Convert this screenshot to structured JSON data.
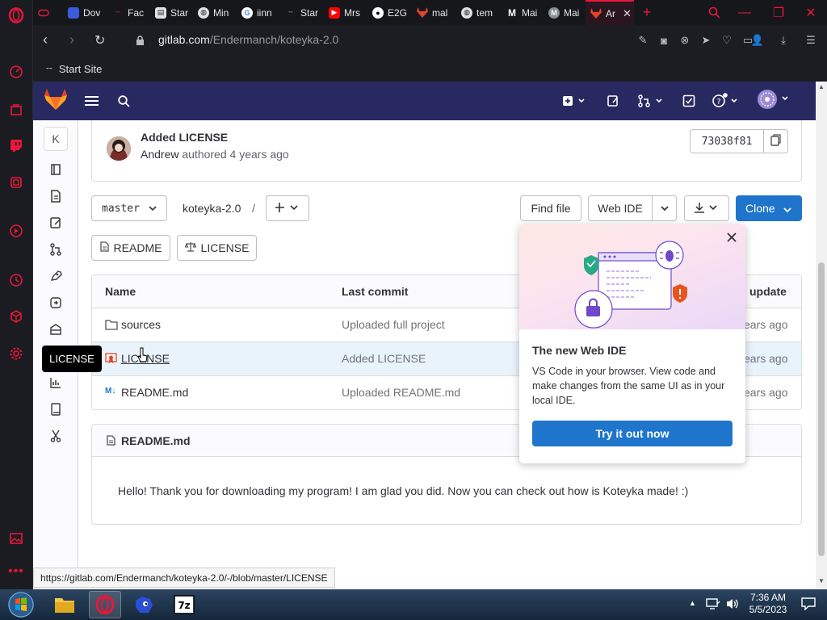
{
  "browser": {
    "tabs": [
      {
        "label": "",
        "fav_color": "#e8173a",
        "icon": "gamepad-icon"
      },
      {
        "label": "Dov",
        "fav_color": "#3b5bdb",
        "icon": "sonic-icon"
      },
      {
        "label": "Fac",
        "fav_color": "#e03131",
        "icon": "dash-icon"
      },
      {
        "label": "Star",
        "fav_color": "#dee2e6",
        "icon": "doc-icon"
      },
      {
        "label": "Min",
        "fav_color": "#dee2e6",
        "icon": "globe-icon"
      },
      {
        "label": "iinn",
        "fav_color": "#ffffff",
        "icon": "google-icon"
      },
      {
        "label": "Star",
        "fav_color": "#868e96",
        "icon": "dash-icon"
      },
      {
        "label": "Mrs",
        "fav_color": "#ff0000",
        "icon": "youtube-icon"
      },
      {
        "label": "E2G",
        "fav_color": "#ffffff",
        "icon": "github-icon"
      },
      {
        "label": "mal",
        "fav_color": "#e24329",
        "icon": "gitlab-icon"
      },
      {
        "label": "tem",
        "fav_color": "#dee2e6",
        "icon": "globe-icon"
      },
      {
        "label": "Mai",
        "fav_color": "#ffffff",
        "icon": "m-icon"
      },
      {
        "label": "Mai",
        "fav_color": "#868e96",
        "icon": "m-icon"
      },
      {
        "label": "Ar",
        "fav_color": "#e24329",
        "icon": "gitlab-icon",
        "active": true
      }
    ],
    "url_host": "gitlab.com",
    "url_path": "/Endermanch/koteyka-2.0",
    "bookmark": "Start Site",
    "status_url": "https://gitlab.com/Endermanch/koteyka-2.0/-/blob/master/LICENSE"
  },
  "project": {
    "avatar_letter": "K",
    "commit": {
      "title": "Added LICENSE",
      "author": "Andrew",
      "authored_text": "authored",
      "time": "4 years ago",
      "sha": "73038f81"
    },
    "branch": "master",
    "path_root": "koteyka-2.0",
    "path_sep": "/",
    "buttons": {
      "find_file": "Find file",
      "web_ide": "Web IDE",
      "clone": "Clone",
      "readme": "README",
      "license": "LICENSE"
    },
    "table": {
      "headers": {
        "name": "Name",
        "last_commit": "Last commit",
        "last_update": "update"
      },
      "rows": [
        {
          "name": "sources",
          "type": "folder",
          "commit": "Uploaded full project",
          "updated": "ears ago"
        },
        {
          "name": "LICENSE",
          "type": "license",
          "commit": "Added LICENSE",
          "updated": "ears ago"
        },
        {
          "name": "README.md",
          "type": "markdown",
          "commit": "Uploaded README.md",
          "updated": "ears ago"
        }
      ]
    },
    "readme": {
      "filename": "README.md",
      "body": "Hello! Thank you for downloading my program! I am glad you did. Now you can check out how is Koteyka made! :)"
    },
    "tooltip": "LICENSE"
  },
  "popover": {
    "title": "The new Web IDE",
    "body": "VS Code in your browser. View code and make changes from the same UI as in your local IDE.",
    "cta": "Try it out now"
  },
  "taskbar": {
    "time": "7:36 AM",
    "date": "5/5/2023"
  },
  "colors": {
    "gitlab_header": "#292961",
    "accent_blue": "#1f75cb",
    "opera_red": "#e8173a"
  }
}
